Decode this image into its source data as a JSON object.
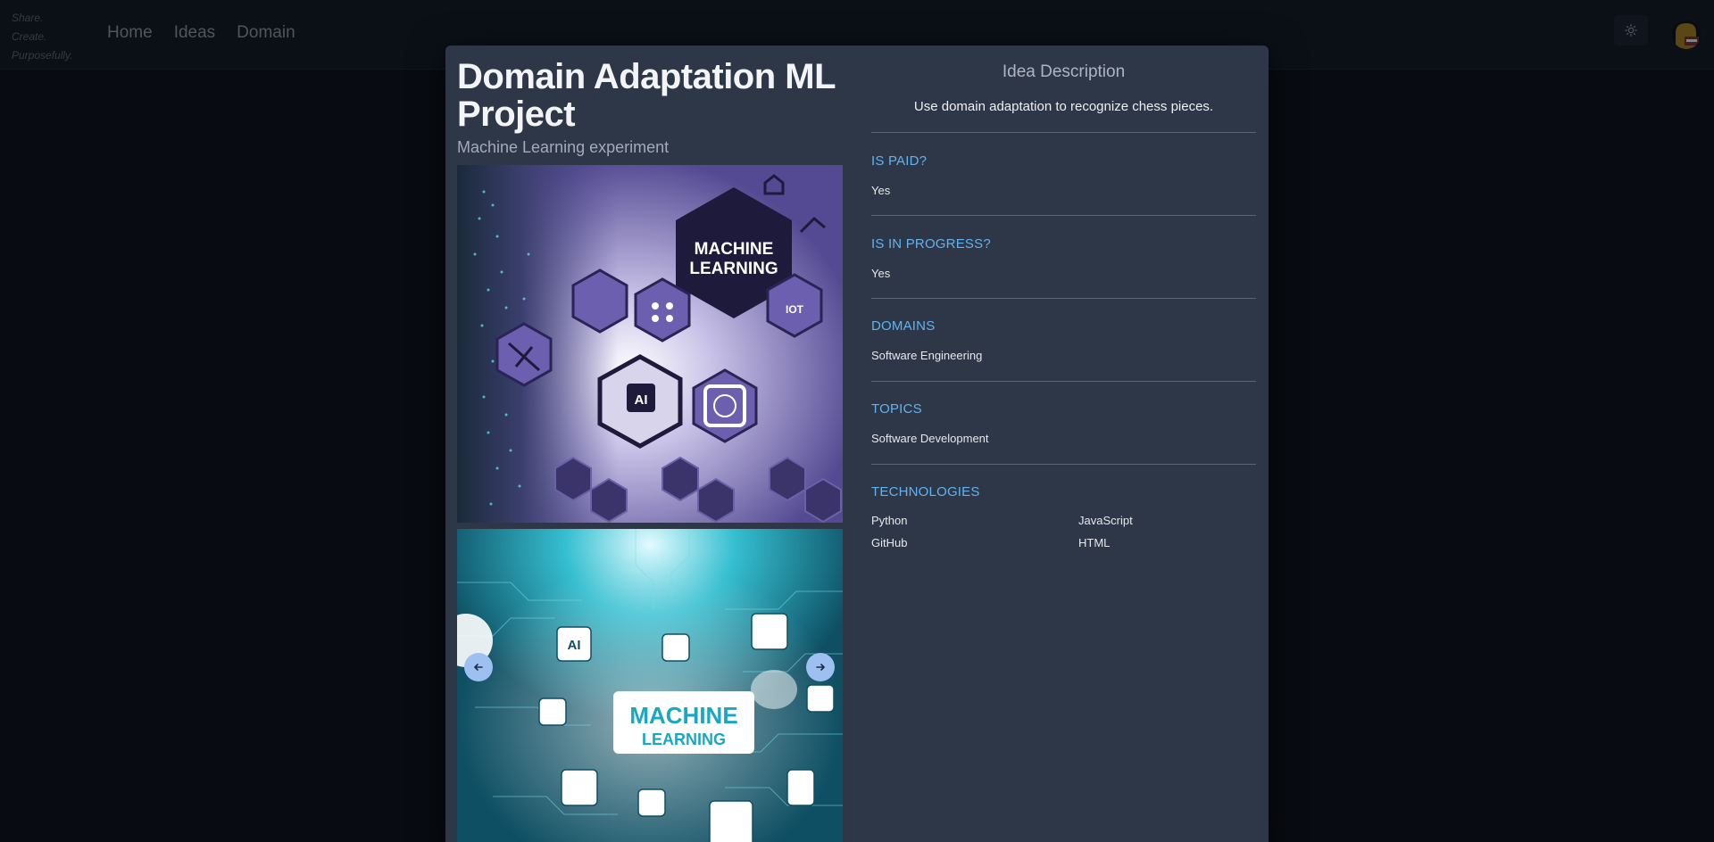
{
  "navbar": {
    "tagline": [
      "Share.",
      "Create.",
      "Purposefully."
    ],
    "links": [
      "Home",
      "Ideas",
      "Domain"
    ],
    "theme_icon": "sun-icon"
  },
  "modal": {
    "title": "Domain Adaptation ML Project",
    "subtitle": "Machine Learning experiment",
    "description_heading": "Idea Description",
    "description": "Use domain adaptation to recognize chess pieces.",
    "sections": [
      {
        "label": "IS PAID?",
        "value": "Yes"
      },
      {
        "label": "IS IN PROGRESS?",
        "value": "Yes"
      },
      {
        "label": "DOMAINS",
        "value": "Software Engineering"
      },
      {
        "label": "TOPICS",
        "value": "Software Development"
      }
    ],
    "technologies_label": "TECHNOLOGIES",
    "technologies": [
      "Python",
      "JavaScript",
      "GitHub",
      "HTML"
    ],
    "carousel": {
      "slide1_text": [
        "MACHINE",
        "LEARNING"
      ],
      "slide2_text": [
        "MACHINE",
        "LEARNING"
      ],
      "prev_icon": "arrow-left-icon",
      "next_icon": "arrow-right-icon"
    }
  },
  "colors": {
    "accent": "#63b3ed",
    "modal_bg": "#2e3748",
    "page_bg": "#0b0e15"
  }
}
